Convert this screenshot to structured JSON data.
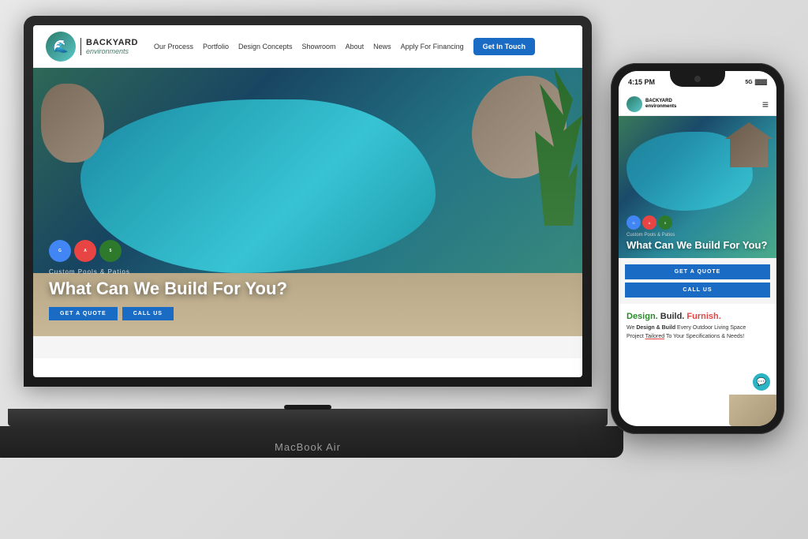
{
  "laptop": {
    "label": "MacBook Air",
    "site": {
      "logo": {
        "icon": "🌊",
        "name": "BACKYARD",
        "sub": "environments"
      },
      "nav": {
        "items": [
          "Our Process",
          "Portfolio",
          "Design Concepts",
          "Showroom",
          "About",
          "News",
          "Apply For Financing"
        ],
        "cta": "Get In Touch"
      },
      "hero": {
        "subtitle": "Custom Pools & Patios",
        "title": "What Can We Build For You?",
        "btn_quote": "GET A QUOTE",
        "btn_call": "CALL US",
        "badges": [
          "Google",
          "Angi 2022",
          "5 Yrs HomeAdvisor"
        ]
      }
    }
  },
  "phone": {
    "status": {
      "time": "4:15 PM",
      "signal": "5G",
      "battery": "▓▓▓"
    },
    "logo": {
      "name": "BACKYARD",
      "sub": "environments"
    },
    "hero": {
      "subtitle": "Custom Pools & Patios",
      "title": "What Can We Build For You?",
      "btn_quote": "GET A QUOTE",
      "btn_call": "CALL US"
    },
    "design_section": {
      "title_design": "Design.",
      "title_build": " Build.",
      "title_furnish": " Furnish.",
      "body_line1": "We Design & Build Every Outdoor Living Space",
      "body_line2": "Project Tailored To Your Specifications & Needs!"
    }
  },
  "icons": {
    "hamburger": "≡",
    "chat": "💬"
  }
}
